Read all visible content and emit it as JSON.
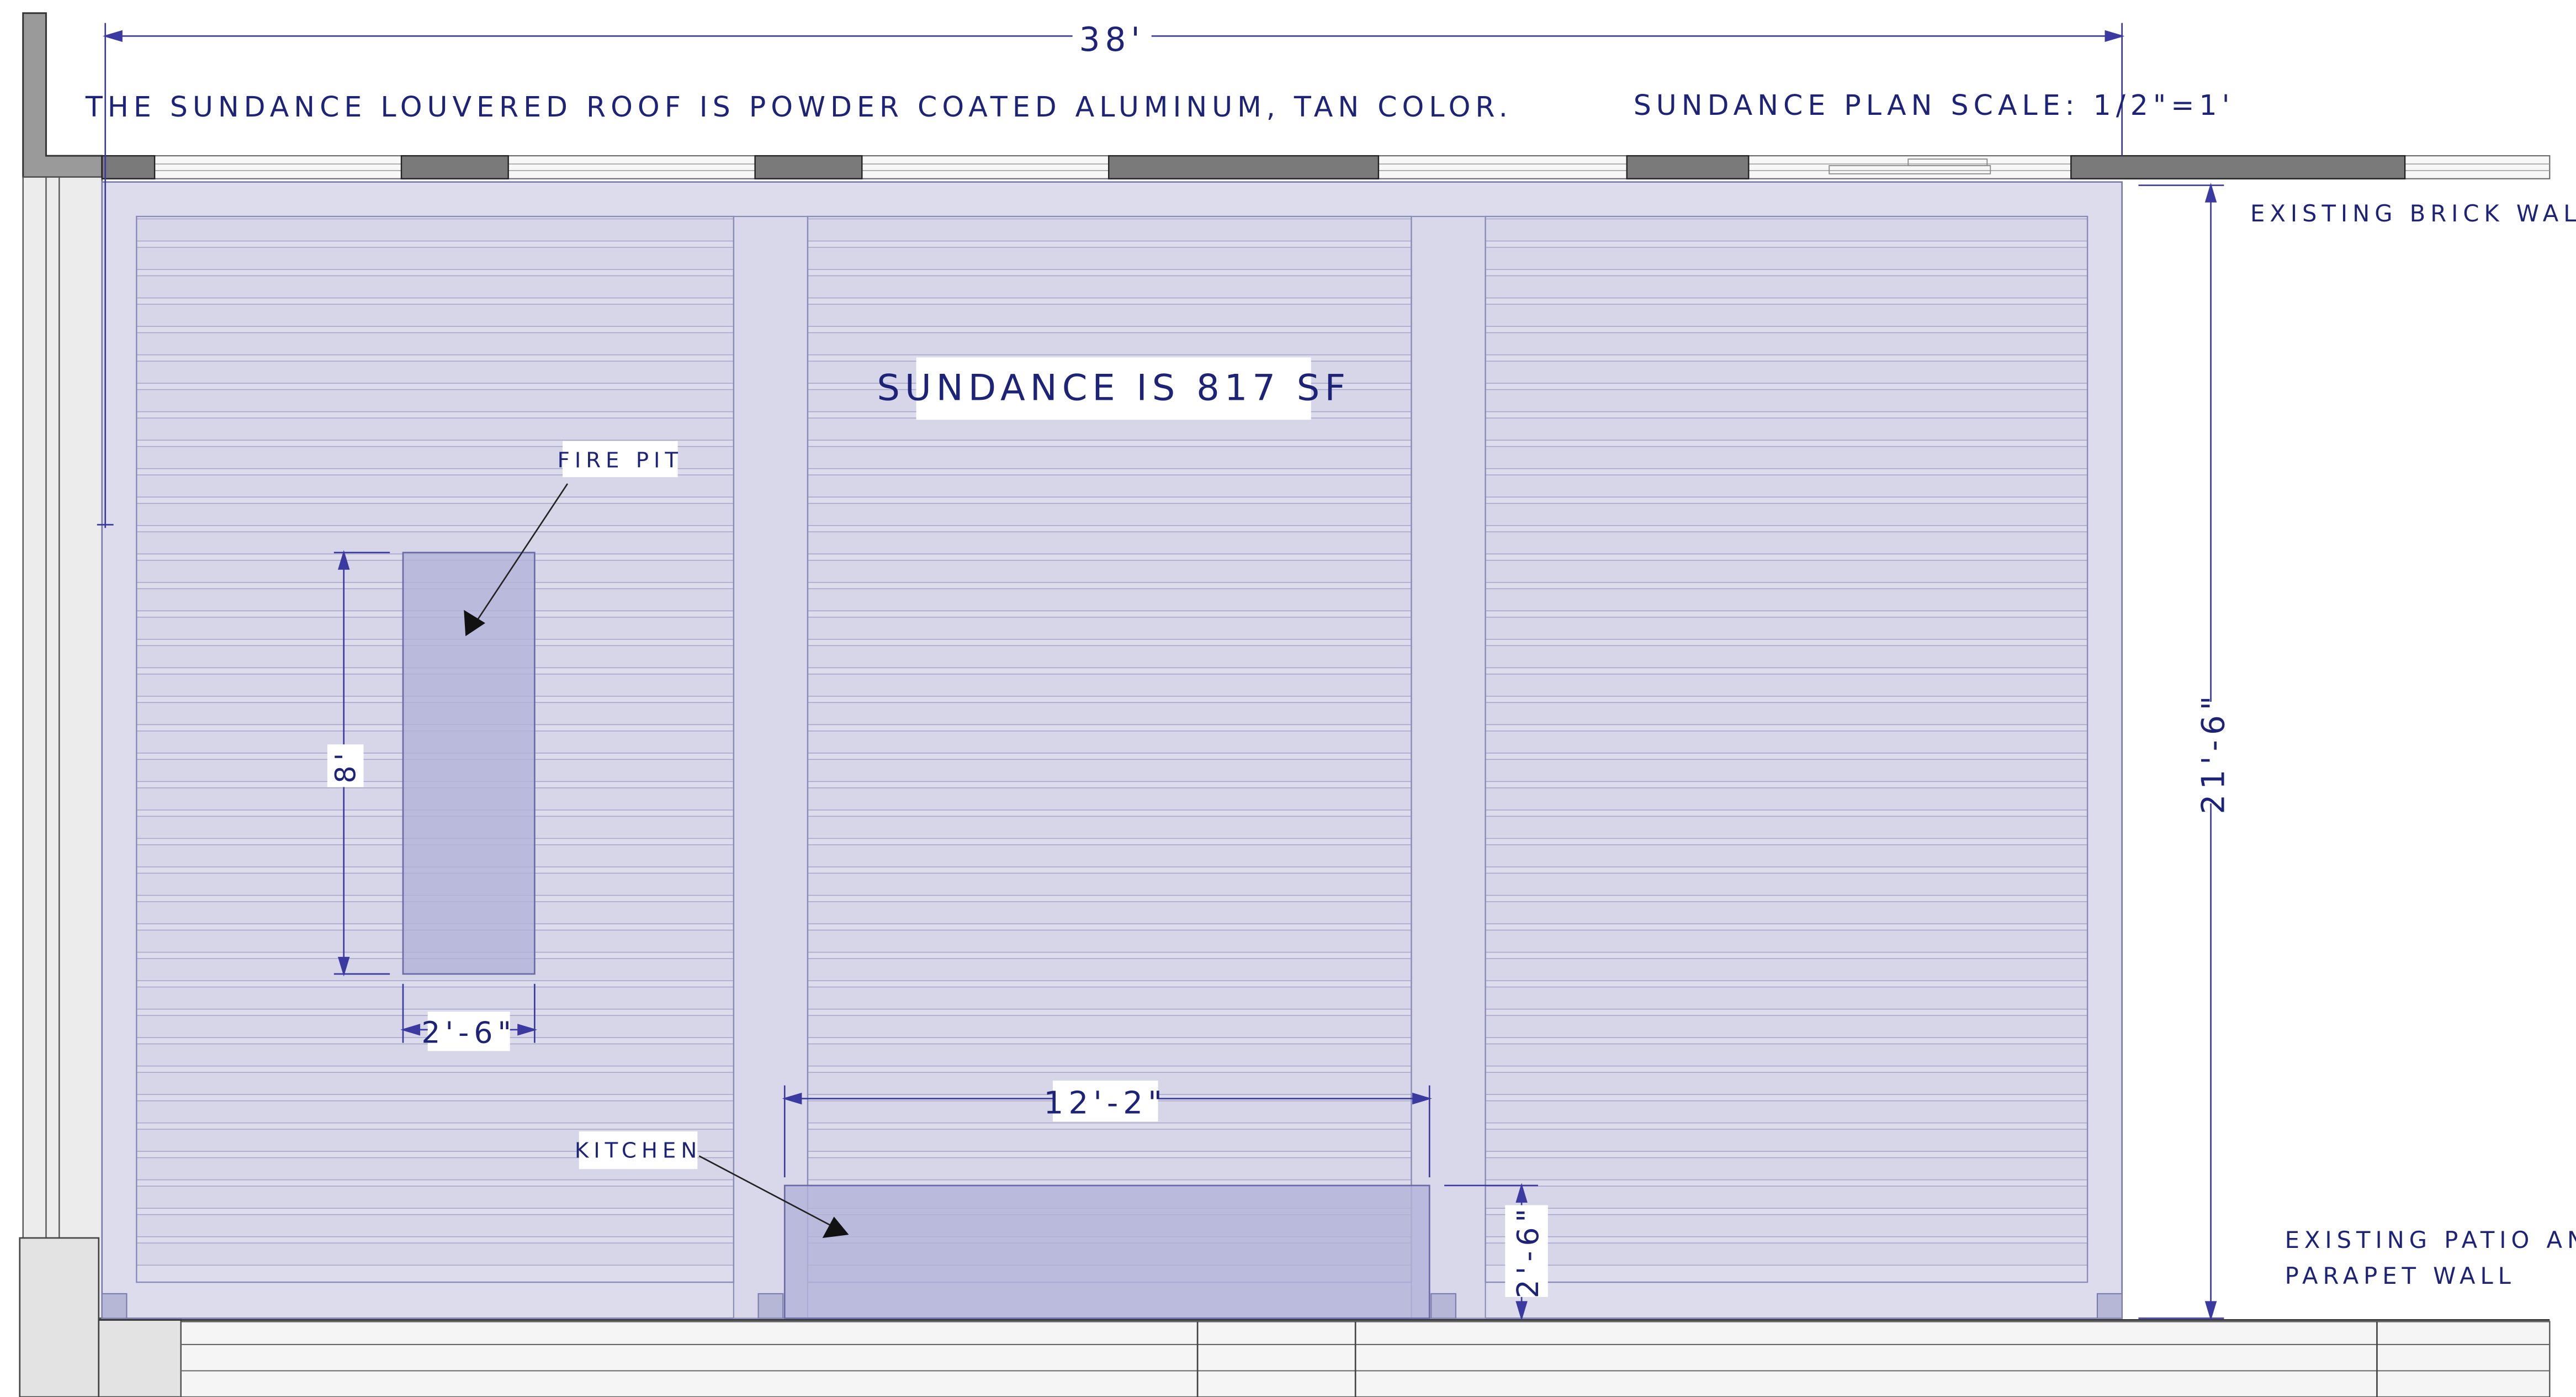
{
  "notes": {
    "material": "THE SUNDANCE LOUVERED ROOF IS POWDER COATED ALUMINUM, TAN COLOR.",
    "scale": "SUNDANCE PLAN SCALE: 1/2\"=1'"
  },
  "area_label": "SUNDANCE IS 817 SF",
  "labels": {
    "brick_wall": "EXISTING BRICK WALL",
    "patio_line1": "EXISTING PATIO AND",
    "patio_line2": "PARAPET WALL",
    "fire_pit": "FIRE PIT",
    "kitchen": "KITCHEN"
  },
  "dimensions": {
    "overall_width": "38'",
    "overall_depth": "21'-6\"",
    "fire_pit_length": "8'",
    "fire_pit_width": "2'-6\"",
    "kitchen_length": "12'-2\"",
    "kitchen_depth": "2'-6\""
  },
  "colors": {
    "ink": "#1d2478",
    "frame": "#dcdcec",
    "louver": "#d6d6e8",
    "feature": "#b3b3d9",
    "wall": "#e0e0e0"
  }
}
